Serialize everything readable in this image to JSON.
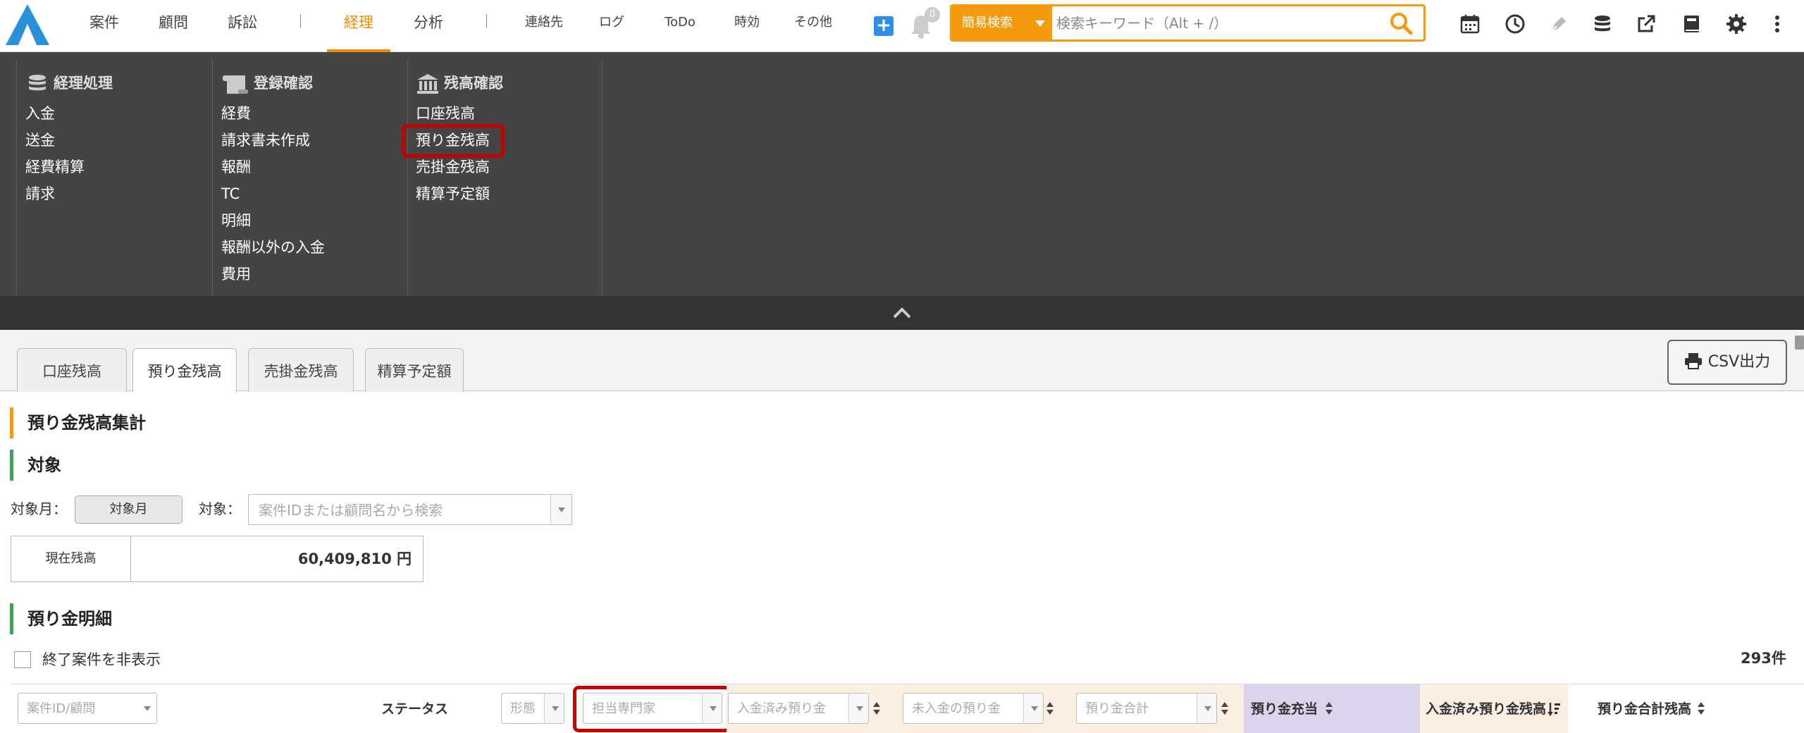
{
  "nav": {
    "items": [
      "案件",
      "顧問",
      "訴訟",
      "経理",
      "分析",
      "連絡先",
      "ログ",
      "ToDo",
      "時効",
      "その他"
    ],
    "active": "経理",
    "notification_count": "0"
  },
  "search": {
    "mode_label": "簡易検索",
    "placeholder": "検索キーワード（Alt + /）"
  },
  "menu": {
    "col1": {
      "title": "経理処理",
      "items": [
        "入金",
        "送金",
        "経費精算",
        "請求"
      ]
    },
    "col2": {
      "title": "登録確認",
      "items": [
        "経費",
        "請求書未作成",
        "報酬",
        "TC",
        "明細",
        "報酬以外の入金",
        "費用"
      ]
    },
    "col3": {
      "title": "残高確認",
      "items": [
        "口座残高",
        "預り金残高",
        "売掛金残高",
        "精算予定額"
      ]
    }
  },
  "tabs": [
    "口座残高",
    "預り金残高",
    "売掛金残高",
    "精算予定額"
  ],
  "active_tab": "預り金残高",
  "csv_button": "CSV出力",
  "summary": {
    "title": "預り金残高集計",
    "target_title": "対象",
    "month_label": "対象月：",
    "month_button": "対象月",
    "target_label": "対象：",
    "target_placeholder": "案件IDまたは顧問名から検索",
    "balance_label": "現在残高",
    "balance_value": "60,409,810 円"
  },
  "details": {
    "title": "預り金明細",
    "hide_closed_label": "終了案件を非表示",
    "count": "293件"
  },
  "columns": {
    "case_id_placeholder": "案件ID/顧問",
    "status": "ステータス",
    "form_placeholder": "形態",
    "attorney_placeholder": "担当専門家",
    "deposited_placeholder": "入金済み預り金",
    "unpaid_placeholder": "未入金の預り金",
    "total_placeholder": "預り金合計",
    "allocation": "預り金充当",
    "deposited_balance": "入金済み預り金残高",
    "total_balance": "預り金合計残高"
  },
  "colors": {
    "accent": "#f08c00",
    "search": "#f59a0c",
    "highlight": "#c80000",
    "menu_bg": "#444444"
  }
}
